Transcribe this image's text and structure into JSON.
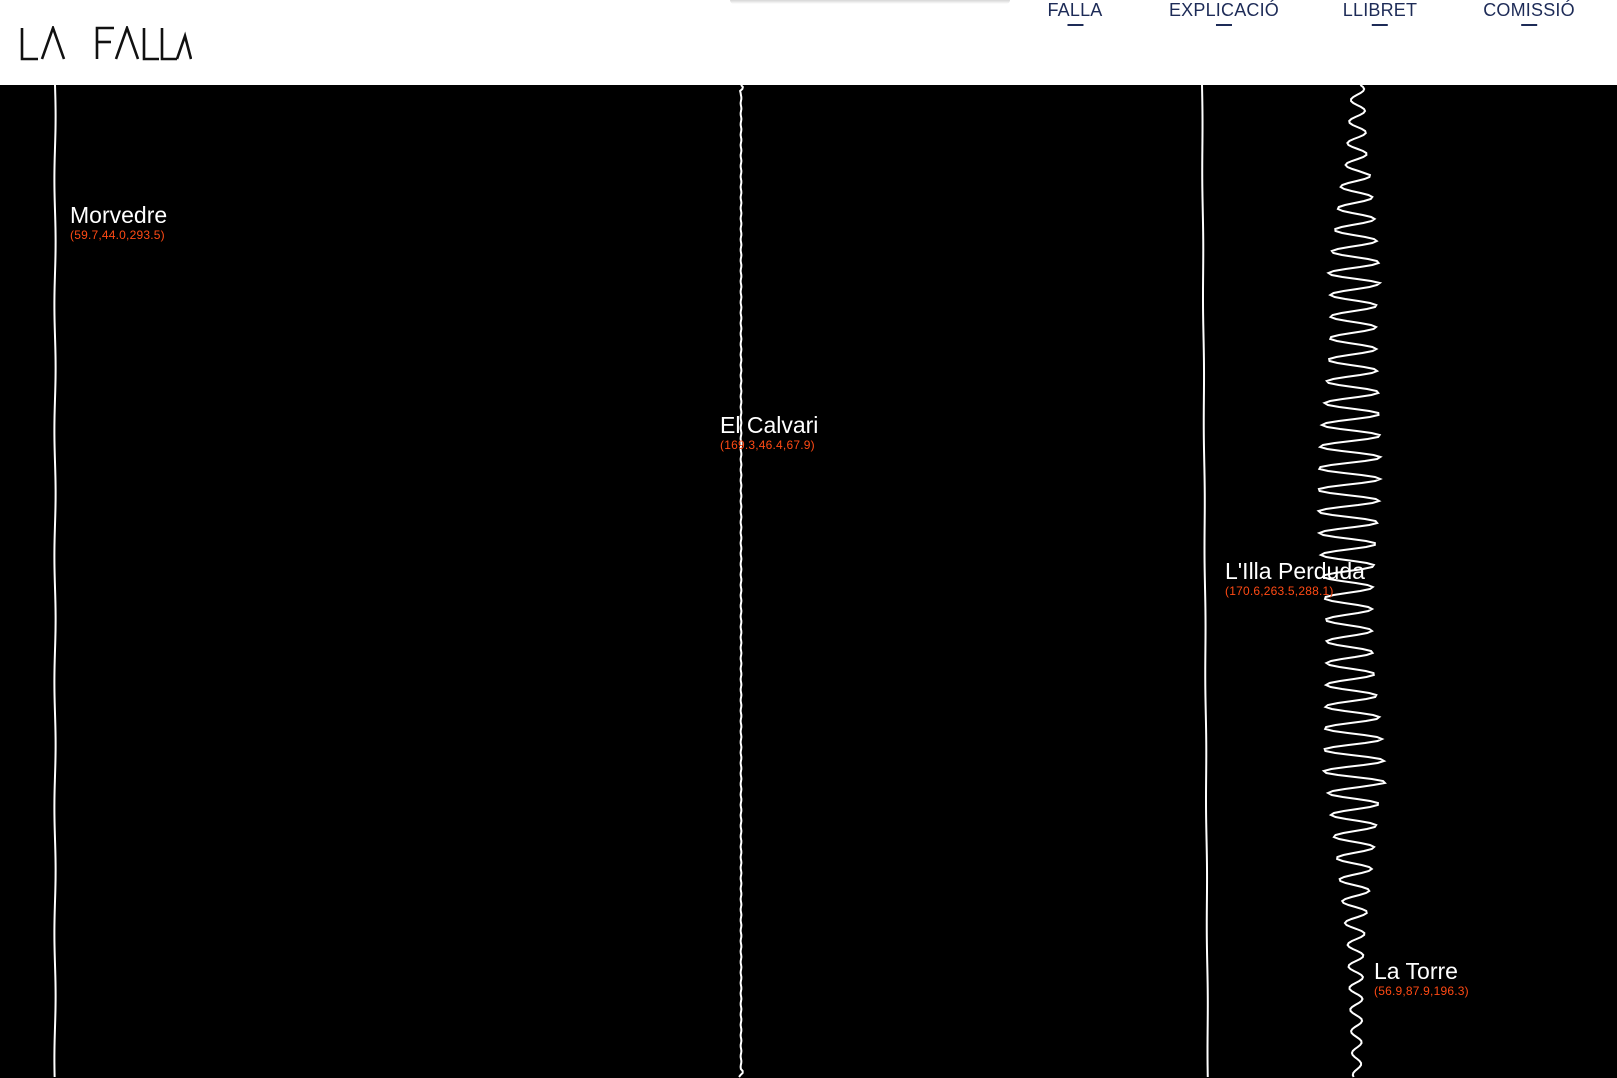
{
  "header": {
    "logo_text": "LA FALLA",
    "nav": [
      {
        "label": "FALLA"
      },
      {
        "label": "EXPLICACIÓ"
      },
      {
        "label": "LLIBRET"
      },
      {
        "label": "COMISSIÓ"
      }
    ]
  },
  "places": [
    {
      "name": "Morvedre",
      "coords": "(59.7,44.0,293.5)"
    },
    {
      "name": "El Calvari",
      "coords": "(169.3,46.4,67.9)"
    },
    {
      "name": "L'Illa Perduda",
      "coords": "(170.6,263.5,288.1)"
    },
    {
      "name": "La Torre",
      "coords": "(56.9,87.9,196.3)"
    }
  ],
  "colors": {
    "background": "#000000",
    "header_background": "#ffffff",
    "nav_text": "#1d2b57",
    "line": "#ffffff",
    "place_name": "#ffffff",
    "place_coords": "#ff4a14"
  }
}
